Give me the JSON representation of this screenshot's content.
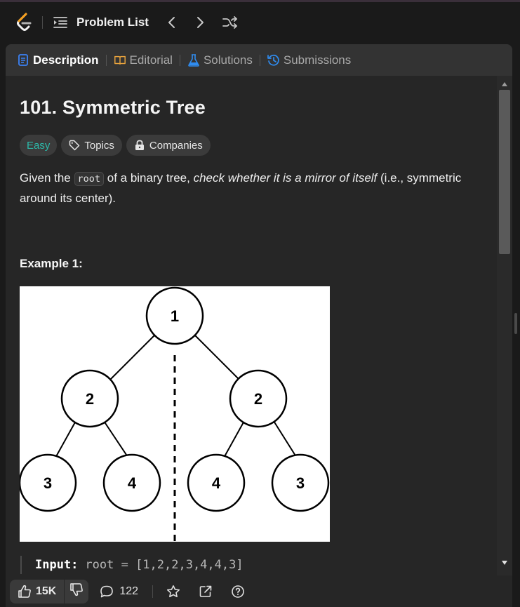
{
  "navbar": {
    "title": "Problem List"
  },
  "tabs": [
    {
      "label": "Description",
      "active": true
    },
    {
      "label": "Editorial",
      "active": false
    },
    {
      "label": "Solutions",
      "active": false
    },
    {
      "label": "Submissions",
      "active": false
    }
  ],
  "problem": {
    "title": "101. Symmetric Tree",
    "difficulty": "Easy",
    "topics_label": "Topics",
    "companies_label": "Companies",
    "desc_part1": "Given the ",
    "desc_code": "root",
    "desc_part2": " of a binary tree, ",
    "desc_italic": "check whether it is a mirror of itself",
    "desc_part3": " (i.e., symmetric around its center).",
    "example_title": "Example 1:",
    "tree_nodes": {
      "root": "1",
      "left": "2",
      "right": "2",
      "ll": "3",
      "lr": "4",
      "rl": "4",
      "rr": "3"
    },
    "input_label": "Input:",
    "input_value": "root = [1,2,2,3,4,4,3]"
  },
  "footer": {
    "likes": "15K",
    "comments": "122"
  },
  "colors": {
    "easy": "#2cbbab",
    "description_icon": "#3b82f6",
    "editorial_icon": "#e8a33d",
    "solutions_icon": "#2f8cf0",
    "submissions_icon": "#2f8cf0"
  }
}
